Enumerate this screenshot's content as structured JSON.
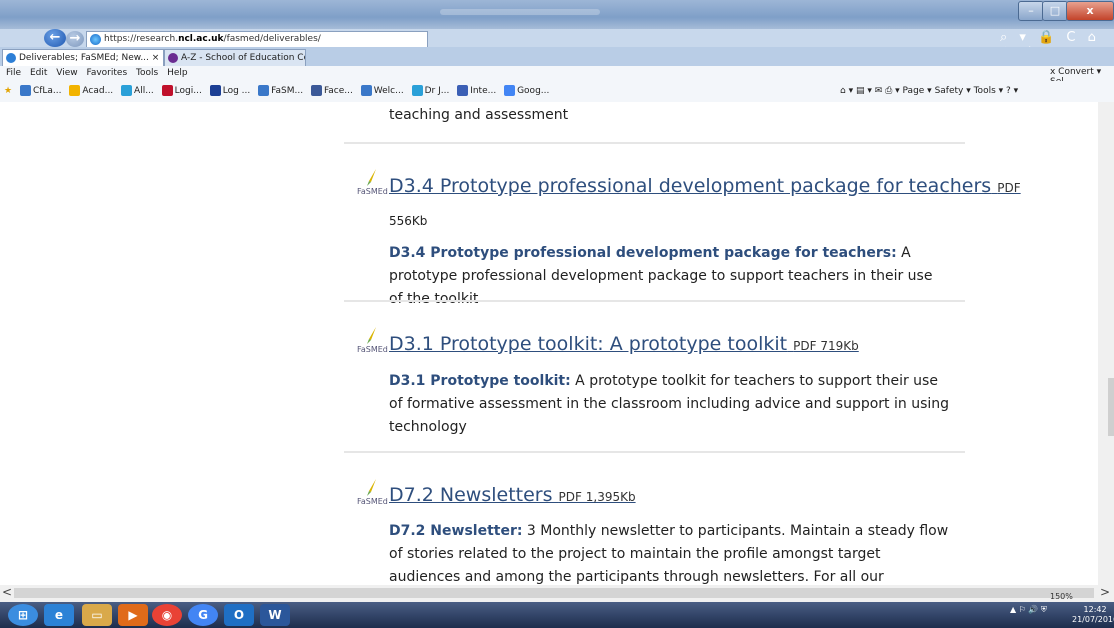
{
  "browser": {
    "url_prefix": "https://research.",
    "url_domain": "ncl.ac.uk",
    "url_path": "/fasmed/deliverables/",
    "tabs": [
      {
        "label": "Deliverables; FaSMEd; New...  ×"
      },
      {
        "label": "A-Z - School of Education Co..."
      }
    ],
    "window_buttons": {
      "minimize": "–",
      "maximize": "□",
      "close": "x"
    },
    "right_nav": "⌕ ▾ 🔒 C  ⌂ ★ ⚙",
    "menu": [
      "File",
      "Edit",
      "View",
      "Favorites",
      "Tools",
      "Help"
    ],
    "menu_right": "x  Convert ▾  Sel",
    "favorites": [
      {
        "label": "CfLa...",
        "color": "#3a78c9"
      },
      {
        "label": "Acad...",
        "color": "#f2b300"
      },
      {
        "label": "All...",
        "color": "#2aa0d8"
      },
      {
        "label": "Logi...",
        "color": "#c0102b"
      },
      {
        "label": "Log ...",
        "color": "#1c3f94"
      },
      {
        "label": "FaSM...",
        "color": "#3a78c9"
      },
      {
        "label": "Face...",
        "color": "#3b5998"
      },
      {
        "label": "Welc...",
        "color": "#3a78c9"
      },
      {
        "label": "Dr J...",
        "color": "#2aa0d8"
      },
      {
        "label": "Inte...",
        "color": "#3b5fb5"
      },
      {
        "label": "Goog...",
        "color": "#4285f4"
      }
    ],
    "command_bar": "⌂ ▾  ▤ ▾  ✉  ⎙ ▾  Page ▾  Safety ▾  Tools ▾  ? ▾"
  },
  "page": {
    "top_text": "teaching and assessment",
    "items": [
      {
        "logo": "FaSMEd",
        "title": "D3.4 Prototype professional development package for teachers",
        "size": "PDF",
        "size2": "556Kb",
        "desc_bold": "D3.4 Prototype professional development package for teachers:",
        "desc": " A prototype professional development package to support teachers in their use of the toolkit"
      },
      {
        "logo": "FaSMEd",
        "title": "D3.1 Prototype toolkit: A prototype toolkit",
        "size": "PDF 719Kb",
        "desc_bold": "D3.1 Prototype toolkit:",
        "desc": " A prototype toolkit for teachers to support their use of formative assessment in the classroom including advice and support in using technology"
      },
      {
        "logo": "FaSMEd",
        "title": "D7.2 Newsletters",
        "size": "PDF 1,395Kb",
        "desc_bold": "D7.2 Newsletter:",
        "desc": " 3 Monthly newsletter to participants. Maintain a steady flow of stories related to the project to maintain the profile amongst target audiences and among the participants through newsletters. For all our newsletters see our"
      }
    ]
  },
  "status": {
    "zoom": "150%",
    "scroll_left": "<",
    "scroll_right": ">"
  },
  "taskbar": {
    "time": "12:42",
    "date": "21/07/2016",
    "apps": [
      {
        "name": "start",
        "label": "⊞",
        "color": "#3b8de0"
      },
      {
        "name": "ie",
        "label": "e",
        "color": "#2c82d6"
      },
      {
        "name": "explorer",
        "label": "▭",
        "color": "#d9a94a"
      },
      {
        "name": "media",
        "label": "▶",
        "color": "#e06b1a"
      },
      {
        "name": "chrome",
        "label": "◉",
        "color": "#e94235"
      },
      {
        "name": "google",
        "label": "G",
        "color": "#4285f4"
      },
      {
        "name": "outlook",
        "label": "O",
        "color": "#1f6fc4"
      },
      {
        "name": "word",
        "label": "W",
        "color": "#2b579a"
      }
    ],
    "tray": "▲  ⚐  🔊  ⛨"
  }
}
